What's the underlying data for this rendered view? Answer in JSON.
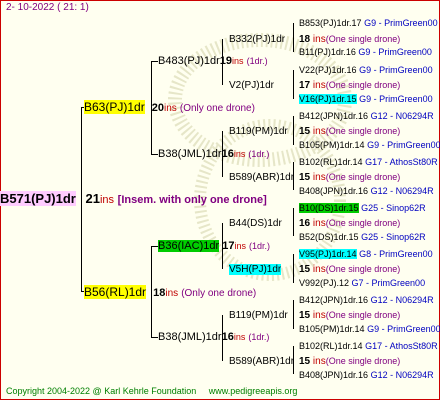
{
  "header": {
    "date": "2- 10-2022 ( 21: 1)"
  },
  "root": {
    "name": "B571(PJ)1dr",
    "ins": "21",
    "ins_unit": "ins",
    "note": "[Insem. with only one drone]"
  },
  "gen1": [
    {
      "name": "B63(PJ)1dr",
      "ins": "20",
      "ins_unit": "ins",
      "note": "(Only one drone)"
    },
    {
      "name": "B56(RL)1dr",
      "ins": "18",
      "ins_unit": "ins",
      "note": "(Only one drone)"
    }
  ],
  "gen2": [
    {
      "name": "B483(PJ)1dr",
      "ins": "19",
      "ins_unit": "ins",
      "note": "(1dr.)"
    },
    {
      "name": "B38(JML)1dr",
      "ins": "16",
      "ins_unit": "ins",
      "note": "(1dr.)"
    },
    {
      "name": "B36(IAC)1dr",
      "ins": "17",
      "ins_unit": "ins",
      "note": "(1dr.)"
    },
    {
      "name": "B38(JML)1dr",
      "ins": "16",
      "ins_unit": "ins",
      "note": "(1dr.)"
    }
  ],
  "gen3": [
    {
      "name": "B332(PJ)1dr",
      "ins": "18",
      "ins_unit": "ins",
      "note": "(One single drone)"
    },
    {
      "name": "V2(PJ)1dr",
      "ins": "17",
      "ins_unit": "ins",
      "note": "(One single drone)"
    },
    {
      "name": "B119(PM)1dr",
      "ins": "15",
      "ins_unit": "ins",
      "note": "(One single drone)"
    },
    {
      "name": "B589(ABR)1dr",
      "ins": "15",
      "ins_unit": "ins",
      "note": "(One single drone)"
    },
    {
      "name": "B44(DS)1dr",
      "ins": "16",
      "ins_unit": "ins",
      "note": "(One single drone)"
    },
    {
      "name": "V5H(PJ)1dr",
      "ins": "15",
      "ins_unit": "ins",
      "note": "(One single drone)"
    },
    {
      "name": "B119(PM)1dr",
      "ins": "15",
      "ins_unit": "ins",
      "note": "(One single drone)"
    },
    {
      "name": "B589(ABR)1dr",
      "ins": "15",
      "ins_unit": "ins",
      "note": "(One single drone)"
    }
  ],
  "gen4": [
    {
      "name": "B853(PJ)1dr.17",
      "src": "G9 - PrimGreen00"
    },
    {
      "name": "B11(PJ)1dr.16",
      "src": "G9 - PrimGreen00"
    },
    {
      "name": "V22(PJ)1dr.16",
      "src": "G9 - PrimGreen00"
    },
    {
      "name": "V16(PJ)1dr.15",
      "src": "G9 - PrimGreen00"
    },
    {
      "name": "B412(JPN)1dr.16",
      "src": "G12 - N06294R"
    },
    {
      "name": "B105(PM)1dr.14",
      "src": "G9 - PrimGreen00"
    },
    {
      "name": "B102(RL)1dr.14",
      "src": "G17 - AthosSt80R"
    },
    {
      "name": "B408(JPN)1dr.16",
      "src": "G12 - N06294R"
    },
    {
      "name": "B10(DS)1dr.15",
      "src": "G25 - Sinop62R"
    },
    {
      "name": "B52(DS)1dr.15",
      "src": "G25 - Sinop62R"
    },
    {
      "name": "V95(PJ)1dr.14",
      "src": "G8 - PrimGreen00"
    },
    {
      "name": "V992(PJ).12",
      "src": "G7 - PrimGreen00"
    },
    {
      "name": "B412(JPN)1dr.16",
      "src": "G12 - N06294R"
    },
    {
      "name": "B105(PM)1dr.14",
      "src": "G9 - PrimGreen00"
    },
    {
      "name": "B102(RL)1dr.14",
      "src": "G17 - AthosSt80R"
    },
    {
      "name": "B408(JPN)1dr.16",
      "src": "G12 - N06294R"
    }
  ],
  "footer": {
    "copyright": "Copyright 2004-2022 @ Karl Kehrle Foundation",
    "url": "www.pedigreeapis.org"
  }
}
